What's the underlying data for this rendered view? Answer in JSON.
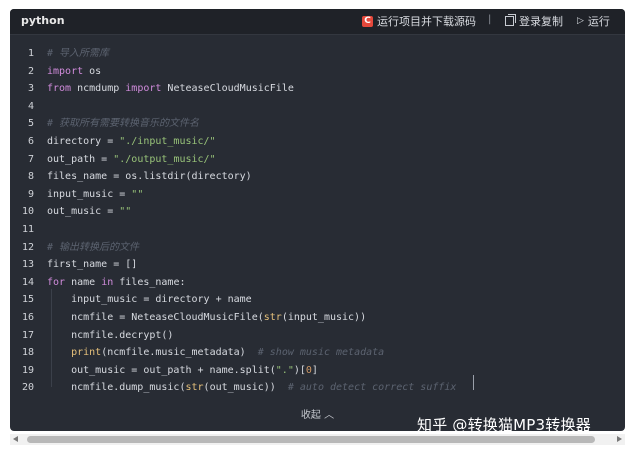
{
  "toolbar": {
    "language": "python",
    "run_source_icon": "C",
    "run_source_label": "运行项目并下载源码",
    "separator": "|",
    "copy_label": "登录复制",
    "run_label": "运行"
  },
  "code_lines": [
    {
      "n": "1",
      "html": "<span class=\"cm\"># 导入所需库</span>"
    },
    {
      "n": "2",
      "html": "<span class=\"kw\">import</span> os"
    },
    {
      "n": "3",
      "html": "<span class=\"kw\">from</span> ncmdump <span class=\"kw\">import</span> NeteaseCloudMusicFile"
    },
    {
      "n": "4",
      "html": ""
    },
    {
      "n": "5",
      "html": "<span class=\"cm\"># 获取所有需要转换音乐的文件名</span>"
    },
    {
      "n": "6",
      "html": "directory = <span class=\"str\">\"./input_music/\"</span>"
    },
    {
      "n": "7",
      "html": "out_path = <span class=\"str\">\"./output_music/\"</span>"
    },
    {
      "n": "8",
      "html": "files_name = os.listdir(directory)"
    },
    {
      "n": "9",
      "html": "input_music = <span class=\"str\">\"\"</span>"
    },
    {
      "n": "10",
      "html": "out_music = <span class=\"str\">\"\"</span>"
    },
    {
      "n": "11",
      "html": ""
    },
    {
      "n": "12",
      "html": "<span class=\"cm\"># 输出转换后的文件</span>"
    },
    {
      "n": "13",
      "html": "first_name = []"
    },
    {
      "n": "14",
      "html": "<span class=\"kw\">for</span> name <span class=\"kw\">in</span> files_name:"
    },
    {
      "n": "15",
      "html": "    input_music = directory + name"
    },
    {
      "n": "16",
      "html": "    ncmfile = NeteaseCloudMusicFile(<span class=\"fn\">str</span>(input_music))"
    },
    {
      "n": "17",
      "html": "    ncmfile.decrypt()"
    },
    {
      "n": "18",
      "html": "    <span class=\"fn\">print</span>(ncmfile.music_metadata)  <span class=\"cm\"># show music metadata</span>"
    },
    {
      "n": "19",
      "html": "    out_music = out_path + name.split(<span class=\"str\">\".\"</span>)[<span class=\"num\">0</span>]"
    },
    {
      "n": "20",
      "html": "    ncmfile.dump_music(<span class=\"fn\">str</span>(out_music))  <span class=\"cm\"># auto detect correct suffix</span>"
    }
  ],
  "collapse_label": "收起 ︿",
  "watermark": "知乎 @转换猫MP3转换器",
  "colors": {
    "panel_bg": "#282c34",
    "keyword": "#d08bdb",
    "string": "#98c379",
    "builtin": "#e5c07b",
    "comment": "#5c6370",
    "run_icon_bg": "#e5483b"
  }
}
